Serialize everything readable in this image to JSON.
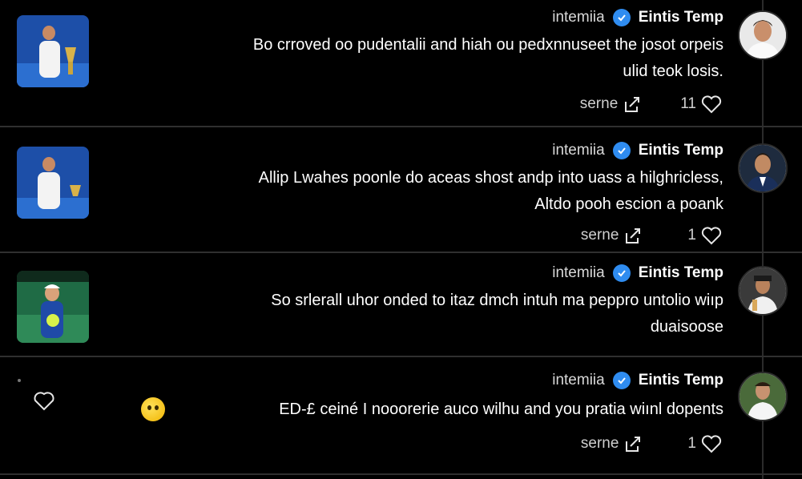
{
  "comments": [
    {
      "author": "Eintis Temp",
      "handle": "intemiia",
      "text_lines": [
        "Bo crroved oo pudentalii and hiah ou pedxnnuseet the josot orpeis",
        "ulid teok losis."
      ],
      "like_count": "11",
      "share_label": "serne"
    },
    {
      "author": "Eintis Temp",
      "handle": "intemiia",
      "text_lines": [
        "Allip Lwahes poonle do aceas shost andp into uass a hilghricless,",
        "Altdo pooh escion a poank"
      ],
      "like_count": "1",
      "share_label": "serne"
    },
    {
      "author": "Eintis Temp",
      "handle": "intemiia",
      "text_lines": [
        "So srlerall uhor onded to itaz dmch intuh ma peppro untolio wiıp",
        "duaisoose"
      ],
      "like_count": "",
      "share_label": ""
    },
    {
      "author": "Eintis Temp",
      "handle": "intemiia",
      "text_lines": [
        "ED-£ ceiné I nooorerie auco wilhu and you pratia wiınl dopents"
      ],
      "like_count": "1",
      "share_label": "serne"
    }
  ],
  "icons": {
    "verified": "verified-badge-icon",
    "like": "heart-icon",
    "share": "share-icon"
  },
  "colors": {
    "background": "#000000",
    "verified": "#2f8cf0",
    "divider": "#2f2f2f"
  }
}
